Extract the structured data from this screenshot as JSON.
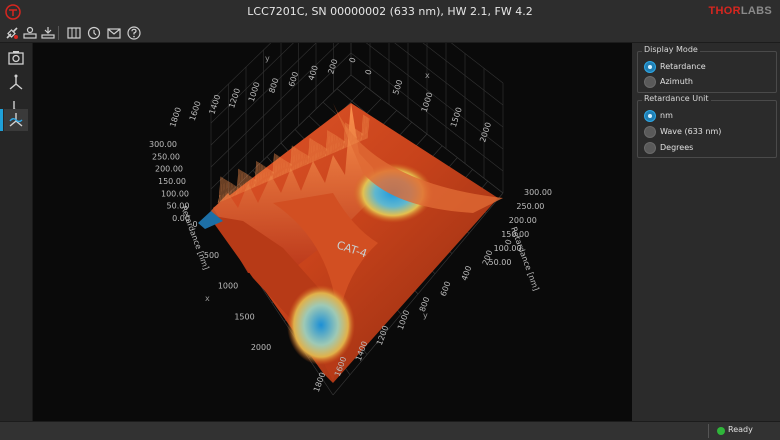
{
  "window": {
    "title": "LCC7201C, SN 00000002 (633 nm), HW 2.1, FW 4.2",
    "brand_main": "THOR",
    "brand_light": "LABS"
  },
  "toolbar": {
    "buttons": [
      "connect-icon",
      "device-settings-icon",
      "download-icon",
      "table-view-icon",
      "refresh-icon",
      "mail-icon",
      "help-icon"
    ]
  },
  "leftbar": {
    "buttons": [
      "camera-view-icon",
      "axis-2d-icon",
      "axis-3d-icon",
      "surface-plot-icon"
    ],
    "active": "surface-plot-icon"
  },
  "display_mode": {
    "title": "Display Mode",
    "options": [
      "Retardance",
      "Azimuth"
    ],
    "selected": "Retardance"
  },
  "retardance_unit": {
    "title": "Retardance Unit",
    "options": [
      "nm",
      "Wave (633 nm)",
      "Degrees"
    ],
    "selected": "nm"
  },
  "status": {
    "text": "Ready",
    "led_color": "#2fb53a"
  },
  "chart_data": {
    "type": "surface",
    "top_axis_ticks": [
      "1800",
      "1600",
      "1400",
      "1200",
      "1000",
      "800",
      "600",
      "400",
      "200",
      "0"
    ],
    "right_top_axis_ticks": [
      "0",
      "500",
      "1000",
      "1500",
      "2000"
    ],
    "left_axis_ticks": [
      "0",
      "500",
      "1000",
      "1500",
      "2000"
    ],
    "bottom_axis_ticks": [
      "0",
      "200",
      "400",
      "600",
      "800",
      "1000",
      "1200",
      "1400",
      "1600",
      "1800"
    ],
    "z_left_ticks": [
      "300.00",
      "250.00",
      "200.00",
      "150.00",
      "100.00",
      "50.00",
      "0.00"
    ],
    "z_right_ticks": [
      "300.00",
      "250.00",
      "200.00",
      "150.00",
      "100.00",
      "50.00"
    ],
    "z_axis_label": "Retardance [nm]",
    "x_axis_letter": "x",
    "y_axis_letter": "y",
    "surface_annotation": "CAT-4"
  }
}
